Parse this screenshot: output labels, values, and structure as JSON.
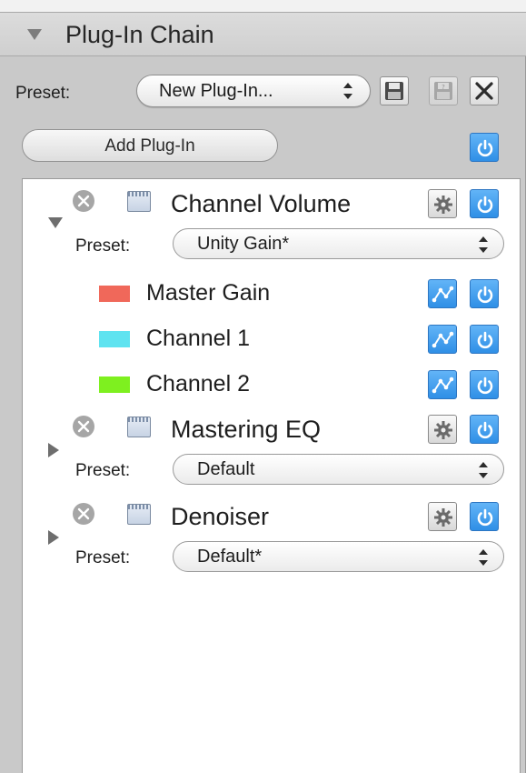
{
  "panel": {
    "title": "Plug-In Chain",
    "preset_label": "Preset:",
    "preset_value": "New Plug-In...",
    "add_plugin_label": "Add Plug-In"
  },
  "plugins": [
    {
      "name": "Channel Volume",
      "expanded": true,
      "preset_label": "Preset:",
      "preset_value": "Unity Gain*",
      "parameters": [
        {
          "name": "Master Gain",
          "color": "#f0685a"
        },
        {
          "name": "Channel 1",
          "color": "#5fe3f0"
        },
        {
          "name": "Channel 2",
          "color": "#7ef01f"
        }
      ]
    },
    {
      "name": "Mastering EQ",
      "expanded": false,
      "preset_label": "Preset:",
      "preset_value": "Default"
    },
    {
      "name": "Denoiser",
      "expanded": false,
      "preset_label": "Preset:",
      "preset_value": "Default*"
    }
  ],
  "colors": {
    "power_blue": "#3b95ea",
    "panel_gray": "#c9c9c9"
  },
  "icons": [
    "disclosure-triangle-icon",
    "save-icon",
    "close-icon",
    "power-icon",
    "remove-icon",
    "plugin-icon",
    "gear-icon",
    "automation-icon",
    "updown-arrows-icon"
  ]
}
